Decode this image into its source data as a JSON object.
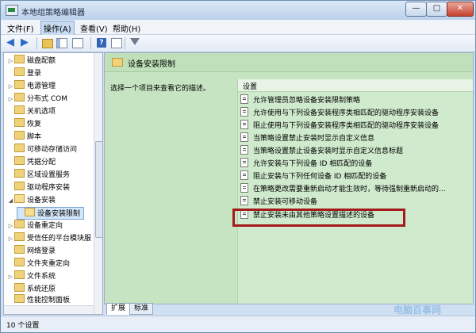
{
  "window": {
    "title": "本地组策略编辑器",
    "min_label": "—",
    "max_label": "□",
    "close_label": "✕"
  },
  "menu": [
    "文件(F)",
    "操作(A)",
    "查看(V)",
    "帮助(H)"
  ],
  "toolbar": {
    "icons": [
      "back-icon",
      "forward-icon",
      "up-folder-icon",
      "show-tree-icon",
      "list-icon",
      "help-icon",
      "properties-icon",
      "filter-icon"
    ],
    "back_glyph": "◀",
    "forward_glyph": "▶",
    "help_glyph": "?"
  },
  "tree": {
    "items": [
      {
        "label": "磁盘配额",
        "expand": "▷"
      },
      {
        "label": "登录",
        "expand": ""
      },
      {
        "label": "电源管理",
        "expand": "▷"
      },
      {
        "label": "分布式 COM",
        "expand": "▷"
      },
      {
        "label": "关机选项",
        "expand": ""
      },
      {
        "label": "恢复",
        "expand": ""
      },
      {
        "label": "脚本",
        "expand": ""
      },
      {
        "label": "可移动存储访问",
        "expand": ""
      },
      {
        "label": "凭据分配",
        "expand": ""
      },
      {
        "label": "区域设置服务",
        "expand": ""
      },
      {
        "label": "驱动程序安装",
        "expand": ""
      },
      {
        "label": "设备安装",
        "expand": "◢"
      },
      {
        "label": "设备安装限制",
        "expand": ""
      },
      {
        "label": "设备重定向",
        "expand": "▷"
      },
      {
        "label": "受信任的平台模块服",
        "expand": "▷"
      },
      {
        "label": "网络登录",
        "expand": ""
      },
      {
        "label": "文件夹重定向",
        "expand": ""
      },
      {
        "label": "文件系统",
        "expand": "▷"
      },
      {
        "label": "系统还原",
        "expand": ""
      },
      {
        "label": "性能控制面板",
        "expand": ""
      }
    ],
    "selected": "设备安装限制"
  },
  "detail": {
    "header": "设备安装限制",
    "description": "选择一个项目来查看它的描述。",
    "column_header": "设置",
    "items": [
      "允许管理员忽略设备安装限制策略",
      "允许使用与下列设备安装程序类相匹配的驱动程序安装设备",
      "阻止使用与下列设备安装程序类相匹配的驱动程序安装设备",
      "当策略设置禁止安装时显示自定义信息",
      "当策略设置禁止设备安装时显示自定义信息标题",
      "允许安装与下列设备 ID 相匹配的设备",
      "阻止安装与下列任何设备 ID 相匹配的设备",
      "在策略更改需要重新启动才能生效时，等待强制重新启动的...",
      "禁止安装可移动设备",
      "禁止安装未由其他策略设置描述的设备"
    ],
    "highlighted": "禁止安装未由其他策略设置描述的设备"
  },
  "tabs": [
    "扩展",
    "标准"
  ],
  "status": "10 个设置",
  "watermark": "电脑百事网"
}
